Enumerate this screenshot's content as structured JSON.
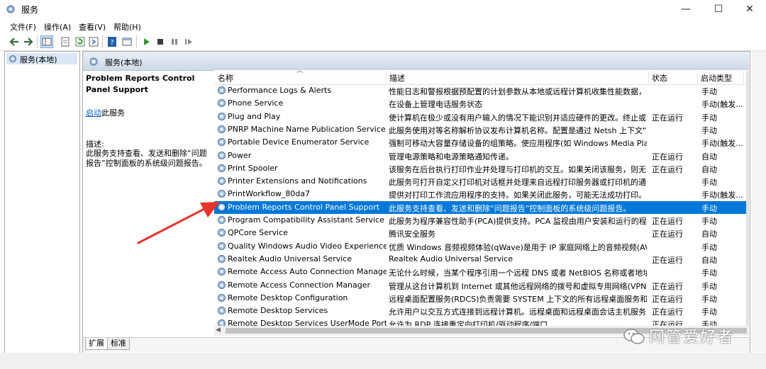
{
  "window": {
    "title": "服务",
    "minimize_glyph": "—",
    "maximize_glyph": "☐",
    "close_glyph": "✕"
  },
  "menu": [
    "文件(F)",
    "操作(A)",
    "查看(V)",
    "帮助(H)"
  ],
  "tree": {
    "item": "服务(本地)"
  },
  "panel": {
    "header": "服务(本地)",
    "description": {
      "title": "Problem Reports Control Panel Support",
      "start_link": "启动",
      "start_suffix": "此服务",
      "heading": "描述:",
      "body": "此服务支持查看、发送和删除“问题报告”控制面板的系统级问题报告。"
    }
  },
  "columns": {
    "name": "名称",
    "desc": "描述",
    "status": "状态",
    "startup": "启动类型"
  },
  "services": [
    {
      "name": "Performance Logs & Alerts",
      "desc": "性能日志和警报根据预配置的计划参数从本地或远程计算机收集性能数据，...",
      "status": "",
      "startup": "手动"
    },
    {
      "name": "Phone Service",
      "desc": "在设备上管理电话服务状态",
      "status": "",
      "startup": "手动(触发..."
    },
    {
      "name": "Plug and Play",
      "desc": "使计算机在极少或没有用户输入的情况下能识别并适应硬件的更改。终止或...",
      "status": "正在运行",
      "startup": "手动"
    },
    {
      "name": "PNRP Machine Name Publication Service",
      "desc": "此服务使用对等名称解析协议发布计算机名称。配置是通过 Netsh 上下文\"p...",
      "status": "",
      "startup": "手动"
    },
    {
      "name": "Portable Device Enumerator Service",
      "desc": "强制可移动大容量存储设备的组策略。使应用程序(如 Windows Media Play...",
      "status": "",
      "startup": "手动(触发..."
    },
    {
      "name": "Power",
      "desc": "管理电源策略和电源策略通知传递。",
      "status": "正在运行",
      "startup": "自动"
    },
    {
      "name": "Print Spooler",
      "desc": "该服务在后台执行打印作业并处理与打印机的交互。如果关闭该服务，则无...",
      "status": "正在运行",
      "startup": "自动"
    },
    {
      "name": "Printer Extensions and Notifications",
      "desc": "此服务可打开自定义打印机对话框并处理来自远程打印服务器或打印机的通...",
      "status": "",
      "startup": "手动"
    },
    {
      "name": "PrintWorkflow_80da7",
      "desc": "提供对打印工作流应用程序的支持。如果关闭此服务，可能无法成功打印。",
      "status": "",
      "startup": "手动(触发..."
    },
    {
      "name": "Problem Reports Control Panel Support",
      "desc": "此服务支持查看、发送和删除“问题报告”控制面板的系统级问题报告。",
      "status": "",
      "startup": "手动",
      "selected": true
    },
    {
      "name": "Program Compatibility Assistant Service",
      "desc": "此服务为程序兼容性助手(PCA)提供支持。PCA 监视由用户安装和运行的程序...",
      "status": "正在运行",
      "startup": "手动"
    },
    {
      "name": "QPCore Service",
      "desc": "腾讯安全服务",
      "status": "正在运行",
      "startup": "自动"
    },
    {
      "name": "Quality Windows Audio Video Experience",
      "desc": "优质 Windows 音频视频体验(qWave)是用于 IP 家庭网络上的音频视频(AV)...",
      "status": "",
      "startup": "手动"
    },
    {
      "name": "Realtek Audio Universal Service",
      "desc": "Realtek Audio Universal Service",
      "status": "正在运行",
      "startup": "自动"
    },
    {
      "name": "Remote Access Auto Connection Manager",
      "desc": "无论什么时候，当某个程序引用一个远程 DNS 或者 NetBIOS 名称或者地址...",
      "status": "",
      "startup": "手动"
    },
    {
      "name": "Remote Access Connection Manager",
      "desc": "管理从这台计算机到 Internet 或其他远程网络的拨号和虚拟专用网络(VPN)...",
      "status": "正在运行",
      "startup": "手动"
    },
    {
      "name": "Remote Desktop Configuration",
      "desc": "远程桌面配置服务(RDCS)负责需要 SYSTEM 上下文的所有远程桌面服务和...",
      "status": "正在运行",
      "startup": "手动"
    },
    {
      "name": "Remote Desktop Services",
      "desc": "允许用户以交互方式连接到远程计算机。远程桌面和远程桌面会话主机服务...",
      "status": "正在运行",
      "startup": "手动"
    },
    {
      "name": "Remote Desktop Services UserMode Port...",
      "desc": "允许为 RDP 连接重定向打印机/驱动程序/端口",
      "status": "正在运行",
      "startup": "手动"
    }
  ],
  "tabs": [
    "扩展",
    "标准"
  ],
  "watermark": "网管爱好者",
  "colors": {
    "selection": "#0078d7",
    "arrow": "#e8332b",
    "link": "#0066cc"
  }
}
